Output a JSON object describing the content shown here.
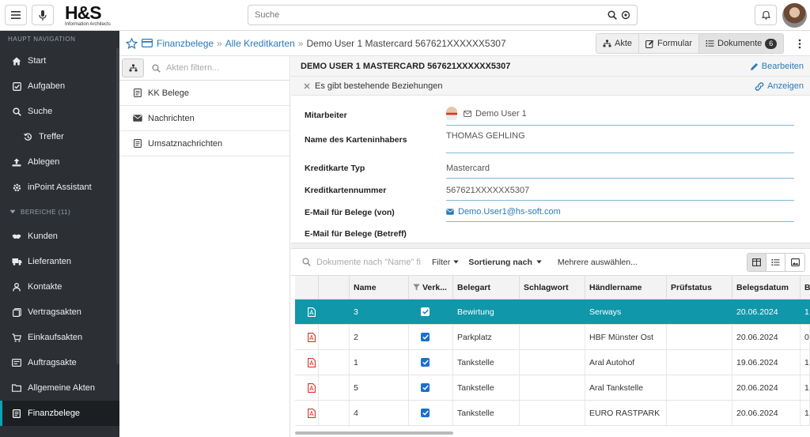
{
  "topbar": {
    "logo_text": "H&S",
    "logo_subtitle": "Information Architects",
    "search_placeholder": "Suche",
    "icons": {
      "menu": "menu-icon",
      "mic": "microphone-icon",
      "search": "search-icon",
      "voice_search": "voice-search-icon",
      "bell": "bell-icon"
    }
  },
  "sidebar": {
    "nav_header": "Haupt Navigation",
    "items": [
      {
        "label": "Start",
        "icon": "home-icon"
      },
      {
        "label": "Aufgaben",
        "icon": "checkbox-icon"
      },
      {
        "label": "Suche",
        "icon": "search-icon"
      },
      {
        "label": "Treffer",
        "icon": "history-icon"
      },
      {
        "label": "Ablegen",
        "icon": "upload-icon"
      },
      {
        "label": "inPoint Assistant",
        "icon": "gear-icon"
      }
    ],
    "areas_header": "Bereiche (11)",
    "areas": [
      {
        "label": "Kunden",
        "icon": "customers-icon"
      },
      {
        "label": "Lieferanten",
        "icon": "truck-icon"
      },
      {
        "label": "Kontakte",
        "icon": "person-icon"
      },
      {
        "label": "Vertragsakten",
        "icon": "contract-icon"
      },
      {
        "label": "Einkaufsakten",
        "icon": "cart-icon"
      },
      {
        "label": "Auftragsakte",
        "icon": "order-icon"
      },
      {
        "label": "Allgemeine Akten",
        "icon": "folder-icon"
      },
      {
        "label": "Finanzbelege",
        "icon": "document-icon"
      }
    ],
    "active": "Finanzbelege"
  },
  "breadcrumb": {
    "items": [
      "Finanzbelege",
      "Alle Kreditkarten",
      "Demo User 1 Mastercard 567621XXXXXX5307"
    ],
    "separator": "»"
  },
  "view_tabs": [
    {
      "label": "Akte",
      "icon": "hierarchy-icon"
    },
    {
      "label": "Formular",
      "icon": "edit-icon"
    },
    {
      "label": "Dokumente",
      "icon": "list-icon",
      "badge": "6"
    }
  ],
  "left_panel": {
    "filter_placeholder": "Akten filtern...",
    "items": [
      {
        "label": "KK Belege",
        "icon": "document-icon"
      },
      {
        "label": "Nachrichten",
        "icon": "envelope-icon"
      },
      {
        "label": "Umsatznachrichten",
        "icon": "document-icon"
      }
    ]
  },
  "record": {
    "title": "DEMO USER 1 MASTERCARD 567621XXXXXX5307",
    "edit_label": "Bearbeiten",
    "notice": "Es gibt bestehende Beziehungen",
    "show_label": "Anzeigen"
  },
  "form": {
    "fields": [
      {
        "label": "Mitarbeiter",
        "value": "Demo User 1"
      },
      {
        "label": "Name des Karteninhabers",
        "value": "THOMAS GEHLING"
      },
      {
        "label": "Kreditkarte Typ",
        "value": "Mastercard"
      },
      {
        "label": "Kreditkartennummer",
        "value": "567621XXXXXX5307"
      },
      {
        "label": "E-Mail für Belege (von)",
        "value": "Demo.User1@hs-soft.com"
      },
      {
        "label": "E-Mail für Belege (Betreff)",
        "value": ""
      }
    ]
  },
  "documents": {
    "search_placeholder": "Dokumente nach \"Name\" fi",
    "filter_label": "Filter",
    "sort_label": "Sortierung nach",
    "multi_select_label": "Mehrere auswählen...",
    "columns": [
      "",
      "",
      "Name",
      "Verk...",
      "Belegart",
      "Schlagwort",
      "Händlername",
      "Prüfstatus",
      "Belegsdatum",
      "B"
    ],
    "rows": [
      {
        "name": "3",
        "belegart": "Bewirtung",
        "schlagwort": "",
        "haendler": "Serways",
        "pruefstatus": "",
        "datum": "20.06.2024",
        "b": "1",
        "selected": true
      },
      {
        "name": "2",
        "belegart": "Parkplatz",
        "schlagwort": "",
        "haendler": "HBF Münster Ost",
        "pruefstatus": "",
        "datum": "20.06.2024",
        "b": "0",
        "selected": false
      },
      {
        "name": "1",
        "belegart": "Tankstelle",
        "schlagwort": "",
        "haendler": "Aral Autohof",
        "pruefstatus": "",
        "datum": "19.06.2024",
        "b": "1",
        "selected": false
      },
      {
        "name": "5",
        "belegart": "Tankstelle",
        "schlagwort": "",
        "haendler": "Aral Tankstelle",
        "pruefstatus": "",
        "datum": "20.06.2024",
        "b": "1",
        "selected": false
      },
      {
        "name": "4",
        "belegart": "Tankstelle",
        "schlagwort": "",
        "haendler": "EURO RASTPARK",
        "pruefstatus": "",
        "datum": "20.06.2024",
        "b": "1",
        "selected": false
      }
    ]
  },
  "colors": {
    "accent": "#1097a9",
    "sidebar_bg": "#2c3035",
    "link": "#2a7ab8",
    "pdf_icon": "#d9342b"
  }
}
